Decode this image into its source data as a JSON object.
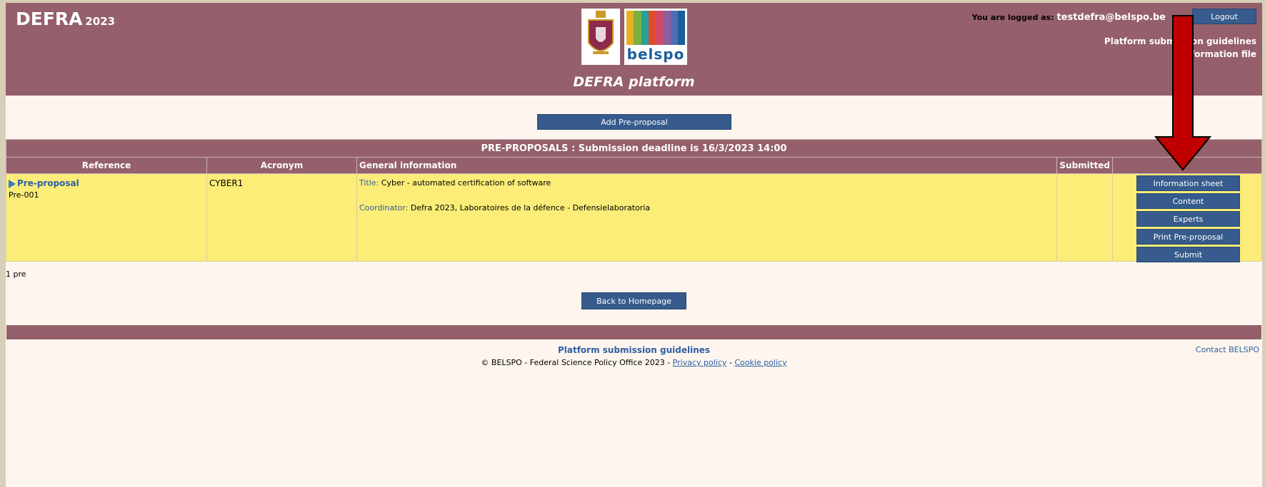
{
  "header": {
    "brand_name": "DEFRA",
    "brand_year": "2023",
    "platform_title": "DEFRA platform",
    "logged_label": "You are logged as:",
    "logged_user": "testdefra@belspo.be",
    "logout_label": "Logout",
    "link_guidelines": "Platform submission guidelines",
    "link_info": "Information file",
    "belspo_logo_text": "belspo",
    "stripe_colors": [
      "#e8b020",
      "#7bb13c",
      "#2aa09a",
      "#e04b2c",
      "#d24a67",
      "#8a5f9c",
      "#4d6db3",
      "#1c5d9c"
    ]
  },
  "actions": {
    "add_preproposal": "Add Pre-proposal",
    "back_homepage": "Back to Homepage"
  },
  "table": {
    "caption": "PRE-PROPOSALS : Submission deadline is 16/3/2023  14:00",
    "columns": [
      "Reference",
      "Acronym",
      "General information",
      "Submitted",
      ""
    ],
    "rows": [
      {
        "type_label": "Pre-proposal",
        "reference": "Pre-001",
        "acronym": "CYBER1",
        "title_label": "Title:",
        "title_value": "Cyber - automated certification of software",
        "coordinator_label": "Coordinator:",
        "coordinator_value": "Defra 2023, Laboratoires de la défence - Defensielaboratoria",
        "submitted": "",
        "buttons": [
          "Information sheet",
          "Content",
          "Experts",
          "Print Pre-proposal",
          "Submit"
        ]
      }
    ],
    "count": "1 pre"
  },
  "footer": {
    "guidelines": "Platform submission guidelines",
    "contact": "Contact BELSPO",
    "copyright": "© BELSPO - Federal Science Policy Office 2023 - ",
    "privacy": "Privacy policy",
    "separator": " - ",
    "cookie": "Cookie policy"
  },
  "colors": {
    "header": "#955f6c",
    "button": "#365b8c",
    "row": "#fbed78",
    "arrow": "#c00000"
  }
}
